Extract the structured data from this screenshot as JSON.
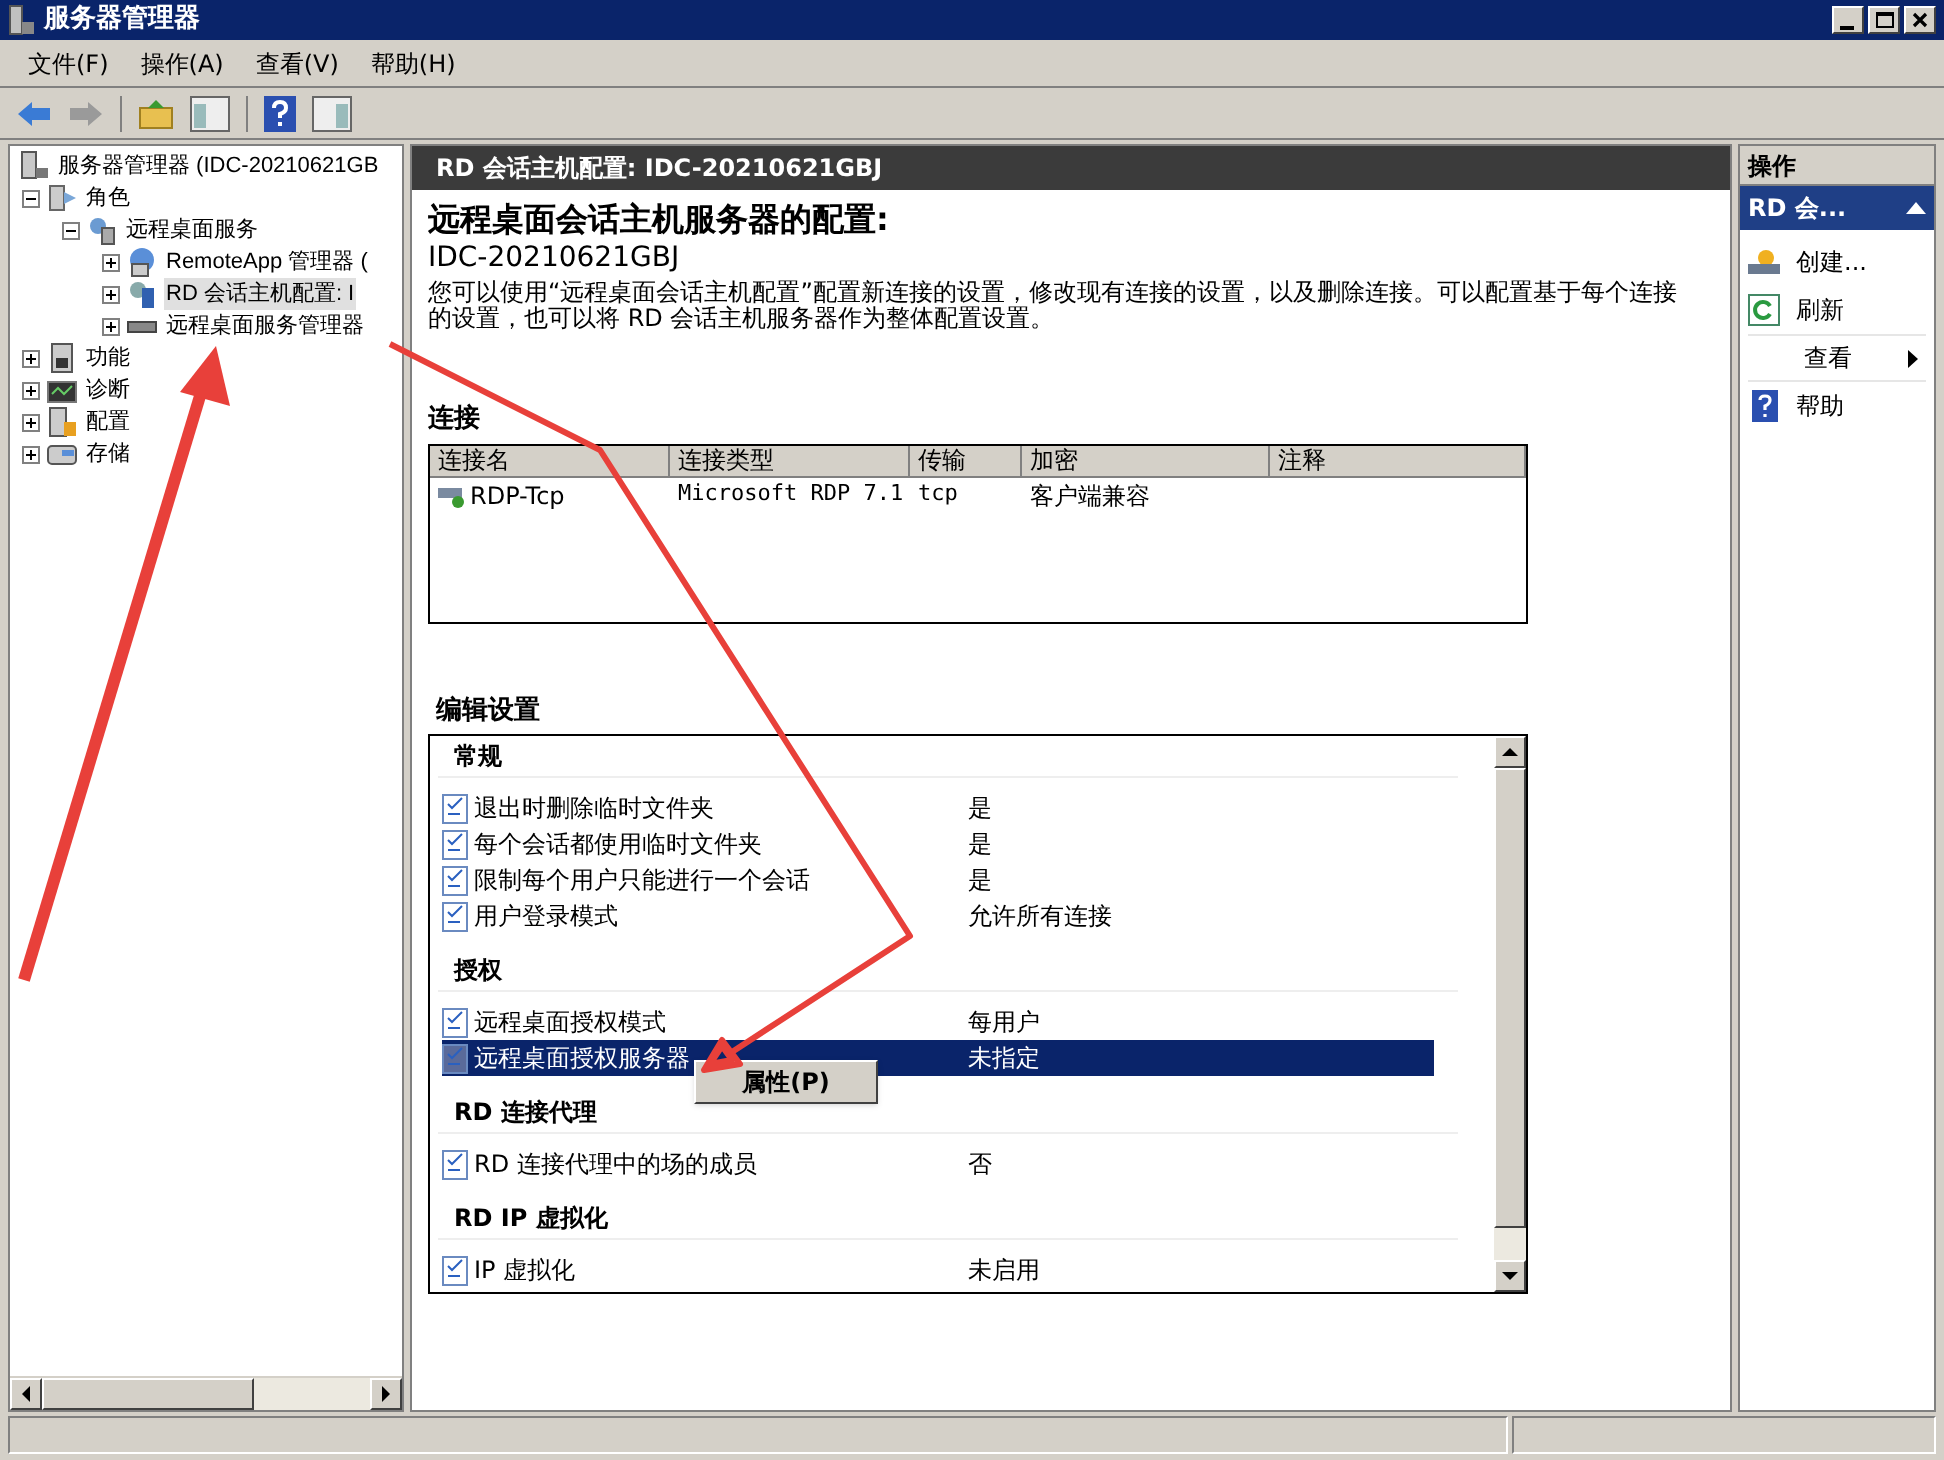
{
  "window": {
    "title": "服务器管理器"
  },
  "menu": [
    "文件(F)",
    "操作(A)",
    "查看(V)",
    "帮助(H)"
  ],
  "tree": [
    {
      "label": "服务器管理器 (IDC-20210621GB",
      "kind": "server",
      "selected": false,
      "children": [
        {
          "label": "角色",
          "kind": "roles",
          "expanded": true,
          "selected": false,
          "children": [
            {
              "label": "远程桌面服务",
              "kind": "service",
              "expanded": true,
              "selected": false,
              "children": [
                {
                  "label": "RemoteApp 管理器 (",
                  "kind": "app",
                  "expanded": false,
                  "selected": false
                },
                {
                  "label": "RD 会话主机配置: I",
                  "kind": "config",
                  "expanded": false,
                  "selected": true
                },
                {
                  "label": "远程桌面服务管理器",
                  "kind": "manager",
                  "expanded": false,
                  "selected": false
                }
              ]
            }
          ]
        },
        {
          "label": "功能",
          "kind": "features",
          "expanded": false,
          "selected": false
        },
        {
          "label": "诊断",
          "kind": "diag",
          "expanded": false,
          "selected": false
        },
        {
          "label": "配置",
          "kind": "config2",
          "expanded": false,
          "selected": false
        },
        {
          "label": "存储",
          "kind": "storage",
          "expanded": false,
          "selected": false
        }
      ]
    }
  ],
  "header": "RD 会话主机配置: IDC-20210621GBJ",
  "heading": "远程桌面会话主机服务器的配置:",
  "host": "IDC-20210621GBJ",
  "description": "您可以使用“远程桌面会话主机配置”配置新连接的设置，修改现有连接的设置，以及删除连接。可以配置基于每个连接的设置，也可以将 RD 会话主机服务器作为整体配置设置。",
  "connections": {
    "title": "连接",
    "columns": [
      "连接名",
      "连接类型",
      "传输",
      "加密",
      "注释"
    ],
    "rows": [
      [
        "RDP-Tcp",
        "Microsoft RDP 7.1",
        "tcp",
        "客户端兼容",
        ""
      ]
    ]
  },
  "settings": {
    "title": "编辑设置",
    "groups": [
      {
        "title": "常规",
        "items": [
          {
            "label": "退出时删除临时文件夹",
            "value": "是",
            "selected": false
          },
          {
            "label": "每个会话都使用临时文件夹",
            "value": "是",
            "selected": false
          },
          {
            "label": "限制每个用户只能进行一个会话",
            "value": "是",
            "selected": false
          },
          {
            "label": "用户登录模式",
            "value": "允许所有连接",
            "selected": false
          }
        ]
      },
      {
        "title": "授权",
        "items": [
          {
            "label": "远程桌面授权模式",
            "value": "每用户",
            "selected": false
          },
          {
            "label": "远程桌面授权服务器",
            "value": "未指定",
            "selected": true
          }
        ]
      },
      {
        "title": "RD 连接代理",
        "items": [
          {
            "label": "RD 连接代理中的场的成员",
            "value": "否",
            "selected": false
          }
        ]
      },
      {
        "title": "RD IP 虚拟化",
        "items": [
          {
            "label": "IP 虚拟化",
            "value": "未启用",
            "selected": false
          }
        ]
      }
    ]
  },
  "context_menu": [
    "属性(P)"
  ],
  "actions": {
    "title": "操作",
    "section": "RD 会...",
    "items": [
      {
        "label": "创建...",
        "kind": "create"
      },
      {
        "label": "刷新",
        "kind": "refresh"
      },
      {
        "label": "查看",
        "kind": "submenu"
      },
      {
        "label": "帮助",
        "kind": "help"
      }
    ]
  }
}
